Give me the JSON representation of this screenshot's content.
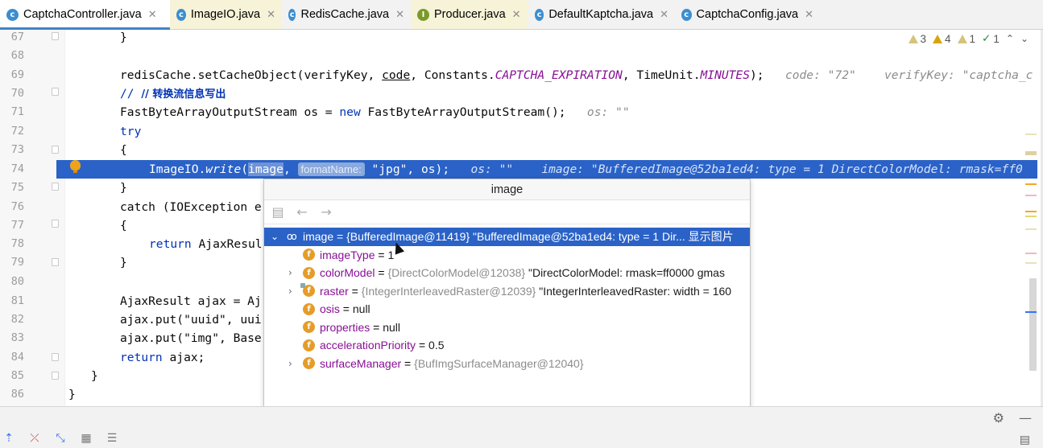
{
  "tabs": [
    {
      "label": "CaptchaController.java",
      "icon": "class-icon",
      "active": true
    },
    {
      "label": "ImageIO.java",
      "icon": "class-icon",
      "active": false
    },
    {
      "label": "RedisCache.java",
      "icon": "class-icon",
      "active": false
    },
    {
      "label": "Producer.java",
      "icon": "interface-icon",
      "active": false
    },
    {
      "label": "DefaultKaptcha.java",
      "icon": "class-icon",
      "active": false
    },
    {
      "label": "CaptchaConfig.java",
      "icon": "class-icon",
      "active": false
    }
  ],
  "inspections": {
    "warnings": "3",
    "weak_warnings": "4",
    "typos": "1",
    "passed": "1"
  },
  "editor": {
    "line_numbers": [
      "67",
      "68",
      "69",
      "70",
      "71",
      "72",
      "73",
      "74",
      "75",
      "76",
      "77",
      "78",
      "79",
      "80",
      "81",
      "82",
      "83",
      "84",
      "85",
      "86"
    ],
    "lines": {
      "l67": "}",
      "l69_a": "redisCache.setCacheObject(verifyKey, ",
      "l69_b": "code",
      "l69_c": ", Constants.",
      "l69_d": "CAPTCHA_EXPIRATION",
      "l69_e": ", TimeUnit.",
      "l69_f": "MINUTES",
      "l69_g": ");",
      "l69_h": "code: \"72\"    verifyKey: \"captcha_c",
      "l70": "// 转换流信息写出",
      "l71_a": "FastByteArrayOutputStream os = ",
      "l71_b": "new",
      "l71_c": " FastByteArrayOutputStream();",
      "l71_d": "os: \"\"",
      "l72": "try",
      "l73": "{",
      "l74_a": "ImageIO.",
      "l74_b": "write",
      "l74_c": "(",
      "l74_d": "image",
      "l74_e": ", ",
      "l74_f": "formatName:",
      "l74_g": " \"jpg\", os);",
      "l74_h": "os: \"\"    image: \"BufferedImage@52ba1ed4: type = 1 DirectColorModel: rmask=ff0",
      "l75": "}",
      "l76": "catch (IOException e",
      "l77": "{",
      "l78_a": "return",
      "l78_b": " AjaxResul",
      "l79": "}",
      "l81": "AjaxResult ajax = Aj",
      "l82": "ajax.put(\"uuid\", uui",
      "l83": "ajax.put(\"img\", Base",
      "l84_a": "return",
      "l84_b": " ajax;",
      "l85": "}",
      "l86": "}"
    }
  },
  "popup": {
    "title": "image",
    "rows": [
      {
        "name": "image",
        "ref": "{BufferedImage@11419}",
        "value": "\"BufferedImage@52ba1ed4: type = 1 Dir... 显示图片"
      },
      {
        "name": "imageType",
        "value": "1"
      },
      {
        "name": "colorModel",
        "ref": "{DirectColorModel@12038}",
        "value": "\"DirectColorModel: rmask=ff0000 gmas"
      },
      {
        "name": "raster",
        "ref": "{IntegerInterleavedRaster@12039}",
        "value": "\"IntegerInterleavedRaster: width = 160"
      },
      {
        "name": "osis",
        "value": "null"
      },
      {
        "name": "properties",
        "value": "null"
      },
      {
        "name": "accelerationPriority",
        "value": "0.5"
      },
      {
        "name": "surfaceManager",
        "ref": "{BufImgSurfaceManager@12040}"
      }
    ]
  },
  "colors": {
    "accent": "#2a62c7",
    "keyword": "#0033b3",
    "constant": "#871094",
    "tab_underline": "#4083c9"
  }
}
